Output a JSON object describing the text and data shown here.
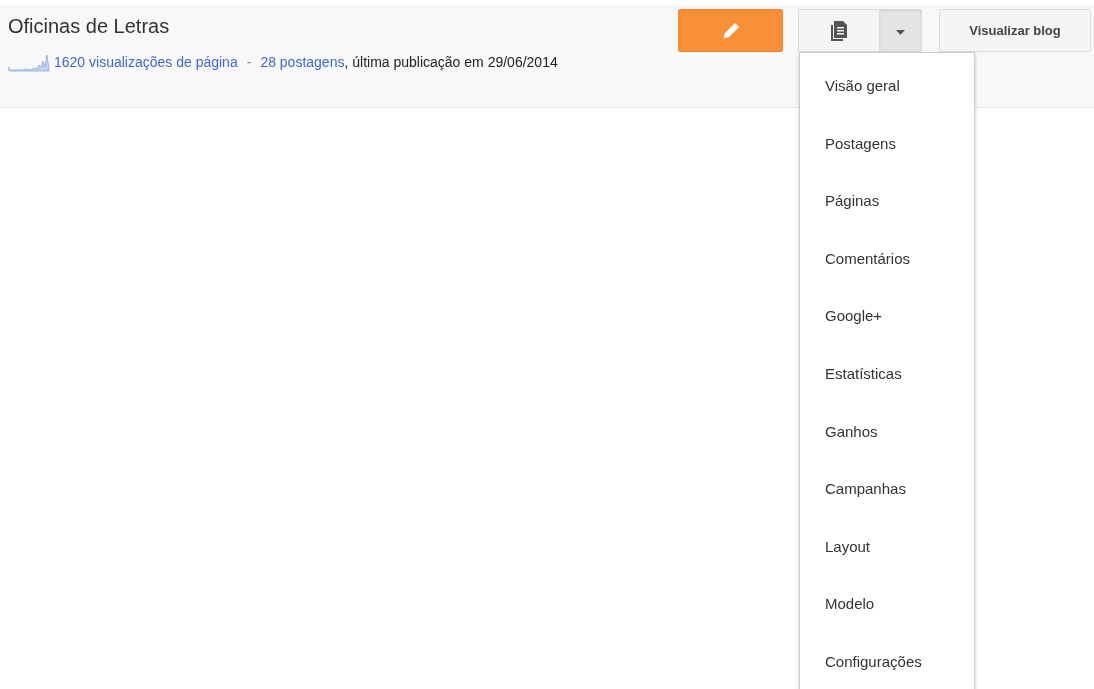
{
  "blog": {
    "title": "Oficinas de Letras",
    "pageviews": "1620 visualizações de página",
    "separator": "-",
    "posts": "28 postagens",
    "last_post": ", última publicação em 29/06/2014"
  },
  "toolbar": {
    "view_blog": "Visualizar blog",
    "menu_expanded": true
  },
  "menu": [
    {
      "label": "Visão geral"
    },
    {
      "label": "Postagens"
    },
    {
      "label": "Páginas"
    },
    {
      "label": "Comentários"
    },
    {
      "label": "Google+"
    },
    {
      "label": "Estatísticas"
    },
    {
      "label": "Ganhos"
    },
    {
      "label": "Campanhas"
    },
    {
      "label": "Layout"
    },
    {
      "label": "Modelo"
    },
    {
      "label": "Configurações"
    }
  ]
}
